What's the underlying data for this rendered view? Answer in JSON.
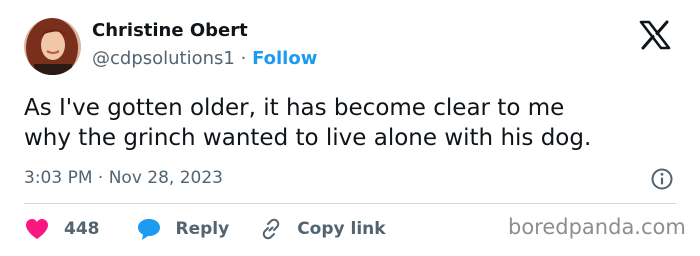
{
  "author": {
    "name": "Christine Obert",
    "handle": "@cdpsolutions1",
    "separator": "·",
    "follow_label": "Follow"
  },
  "tweet": {
    "lines": [
      "As I've gotten older, it has become clear to me",
      "why the grinch wanted to live alone with his dog."
    ],
    "timestamp": "3:03 PM · Nov 28, 2023"
  },
  "actions": {
    "like_count": "448",
    "reply_label": "Reply",
    "copy_link_label": "Copy link"
  },
  "watermark": "boredpanda.com",
  "icons": {
    "logo": "x-logo-icon",
    "info": "info-icon",
    "like": "heart-icon",
    "reply": "speech-bubble-icon",
    "copy": "link-icon"
  },
  "colors": {
    "accent": "#1d9bf0",
    "heart": "#f91880",
    "text": "#0f1419",
    "secondary": "#536471"
  }
}
